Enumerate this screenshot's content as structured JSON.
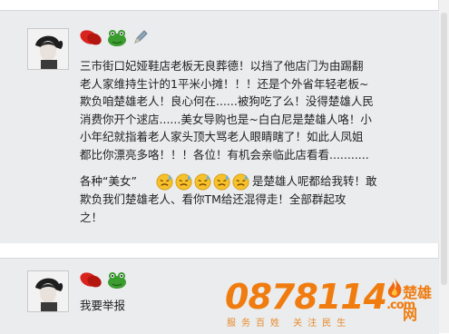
{
  "post1": {
    "body": "三市街口妃娅鞋店老板无良葬德！以挡了他店门为由踢翻\n老人家维持生计的1平米小摊！！！还是个外省年轻老板~\n欺负咱楚雄老人！良心何在......被狗吃了么！没得楚雄人民\n消费你开个逑店......美女导购也是~白白尼是楚雄人咯！小\n小年纪就指着老人家头顶大骂老人眼睛瞎了！如此人凤姐\n都比你漂亮多咯！！！各位！有机会亲临此店看看...........",
    "line7_pre": "各种“美女”",
    "line7_post": "是楚雄人呢都给我转！敢",
    "tail": "欺负我们楚雄老人、看你TM给还混得走！全部群起攻\n之！",
    "emojis": [
      "sweat-emoji",
      "sweat-emoji",
      "sweat-emoji",
      "sweat-emoji",
      "sweat-emoji"
    ]
  },
  "post2": {
    "body": "我要举报"
  },
  "badges": [
    "red-lips-badge",
    "frog-badge",
    "pencil-badge"
  ],
  "logo": {
    "number": "0878114",
    "suffix": ".com",
    "site_name": "楚雄网",
    "slogan": "服务百姓  关注民生"
  },
  "colors": {
    "post_bg": "#eaeced",
    "accent": "#f07c10"
  }
}
